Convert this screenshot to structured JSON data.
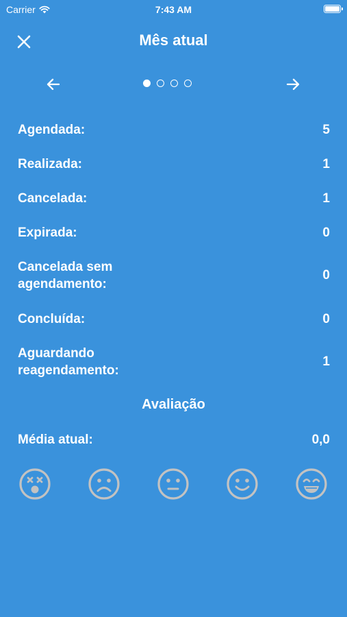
{
  "status_bar": {
    "carrier": "Carrier",
    "time": "7:43 AM"
  },
  "header": {
    "title": "Mês atual"
  },
  "pager": {
    "total_pages": 4,
    "active_page": 1
  },
  "stats": [
    {
      "label": "Agendada:",
      "value": "5"
    },
    {
      "label": "Realizada:",
      "value": "1"
    },
    {
      "label": "Cancelada:",
      "value": "1"
    },
    {
      "label": "Expirada:",
      "value": "0"
    },
    {
      "label_line1": "Cancelada sem",
      "label_line2": "agendamento:",
      "value": "0"
    },
    {
      "label": "Concluída:",
      "value": "0"
    },
    {
      "label_line1": "Aguardando",
      "label_line2": "reagendamento:",
      "value": "1"
    }
  ],
  "rating": {
    "section_title": "Avaliação",
    "label": "Média atual:",
    "value": "0,0"
  },
  "faces": [
    "dizzy-face-icon",
    "sad-face-icon",
    "neutral-face-icon",
    "smile-face-icon",
    "grin-face-icon"
  ],
  "colors": {
    "background": "#3a92dc",
    "text": "#ffffff",
    "face_icon": "#c2c2c2"
  }
}
